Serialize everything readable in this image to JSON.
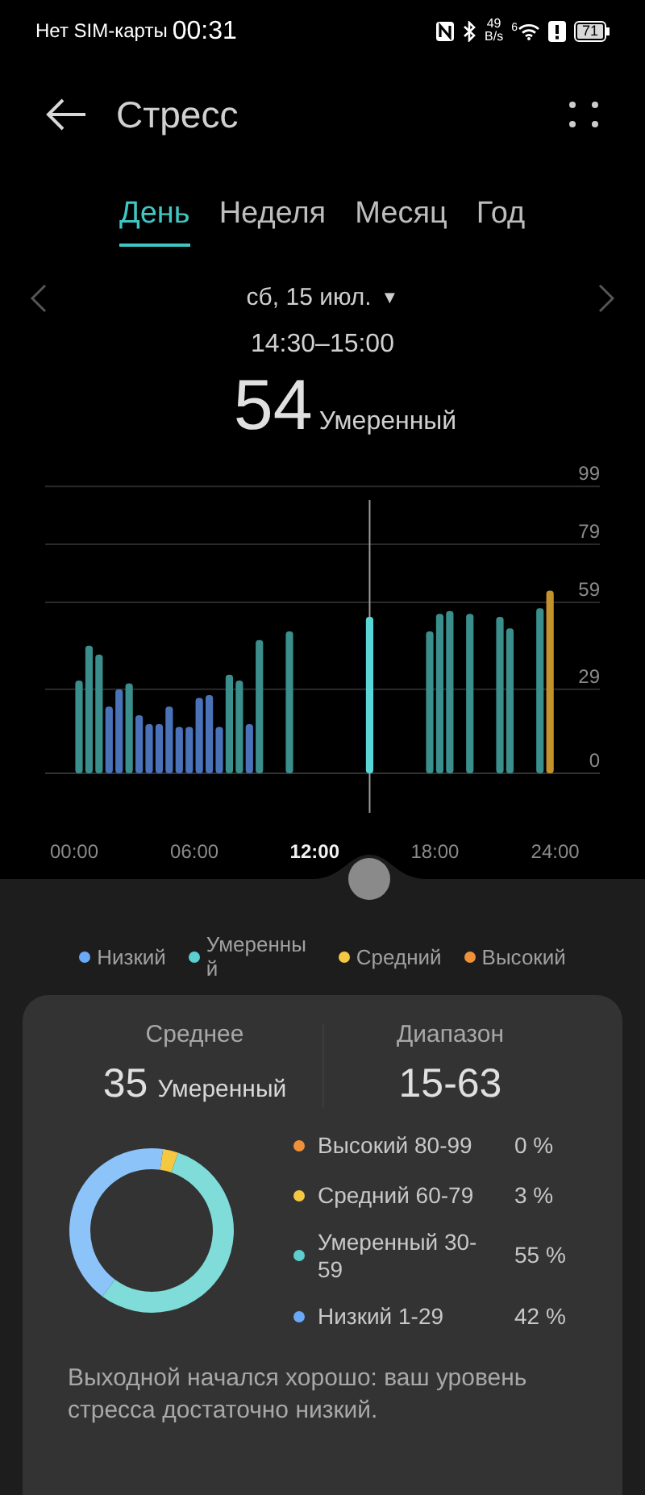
{
  "status_bar": {
    "carrier": "Нет SIM-карты",
    "time": "00:31",
    "net_speed_value": "49",
    "net_speed_unit": "B/s",
    "wifi_label": "6",
    "battery": "71"
  },
  "header": {
    "title": "Стресс"
  },
  "tabs": [
    {
      "label": "День",
      "selected": true
    },
    {
      "label": "Неделя",
      "selected": false
    },
    {
      "label": "Месяц",
      "selected": false
    },
    {
      "label": "Год",
      "selected": false
    }
  ],
  "date_picker": {
    "date": "сб, 15 июл.",
    "dropdown_glyph": "▼"
  },
  "selection": {
    "interval": "14:30–15:00",
    "value": "54",
    "level_label": "Умеренный"
  },
  "chart": {
    "chart_data": {
      "type": "bar",
      "grid": true,
      "ref_lines": [
        {
          "axis": "x",
          "value": 14.5,
          "color": "#9a9a9a"
        }
      ],
      "x": [
        0,
        0.5,
        1,
        1.5,
        2,
        2.5,
        3,
        3.5,
        4,
        4.5,
        5,
        5.5,
        6,
        6.5,
        7,
        7.5,
        8,
        8.5,
        9,
        10.5,
        14.5,
        17.5,
        18,
        18.5,
        19.5,
        21,
        21.5,
        23,
        23.5
      ],
      "series": [
        {
          "color": "#4a72b8",
          "values": [
            null,
            null,
            null,
            23,
            29,
            null,
            20,
            17,
            17,
            23,
            16,
            16,
            26,
            27,
            16,
            null,
            null,
            17,
            null,
            null,
            null,
            null,
            null,
            null,
            null,
            null,
            null,
            null,
            null
          ]
        },
        {
          "color": "#3a8e8c",
          "values": [
            32,
            44,
            41,
            null,
            null,
            31,
            null,
            null,
            null,
            null,
            null,
            null,
            null,
            null,
            null,
            34,
            32,
            null,
            46,
            49,
            null,
            49,
            55,
            56,
            55,
            54,
            50,
            57,
            null
          ]
        },
        {
          "color": "#5ad6d6",
          "values": [
            null,
            null,
            null,
            null,
            null,
            null,
            null,
            null,
            null,
            null,
            null,
            null,
            null,
            null,
            null,
            null,
            null,
            null,
            null,
            null,
            54,
            null,
            null,
            null,
            null,
            null,
            null,
            null,
            null
          ]
        },
        {
          "color": "#c4922c",
          "values": [
            null,
            null,
            null,
            null,
            null,
            null,
            null,
            null,
            null,
            null,
            null,
            null,
            null,
            null,
            null,
            null,
            null,
            null,
            null,
            null,
            null,
            null,
            null,
            null,
            null,
            null,
            null,
            null,
            63
          ]
        }
      ],
      "xlim": [
        0,
        24
      ],
      "ylim": [
        0,
        99
      ],
      "xticks": [
        {
          "value": 0,
          "label": "00:00"
        },
        {
          "value": 6,
          "label": "06:00"
        },
        {
          "value": 12,
          "label": "12:00"
        },
        {
          "value": 18,
          "label": "18:00"
        },
        {
          "value": 24,
          "label": "24:00"
        }
      ],
      "yticks": [
        99,
        79,
        59,
        29,
        0
      ]
    }
  },
  "legend": [
    {
      "label": "Низкий",
      "color": "#6aa9f5"
    },
    {
      "label": "Умеренный",
      "color": "#5ccfcf"
    },
    {
      "label": "Средний",
      "color": "#f5c842"
    },
    {
      "label": "Высокий",
      "color": "#f0913a"
    }
  ],
  "summary": {
    "average_label": "Среднее",
    "average_value": "35",
    "average_level": "Умеренный",
    "range_label": "Диапазон",
    "range_value": "15-63"
  },
  "distribution": [
    {
      "label": "Высокий 80-99",
      "percent": "0 %",
      "color": "#f0913a"
    },
    {
      "label": "Средний 60-79",
      "percent": "3 %",
      "color": "#f5c842"
    },
    {
      "label": "Умеренный 30-59",
      "percent": "55 %",
      "color": "#5ccfcf"
    },
    {
      "label": "Низкий 1-29",
      "percent": "42 %",
      "color": "#6aa9f5"
    }
  ],
  "donut": {
    "chart_data": {
      "type": "donut",
      "values": [
        3,
        55,
        42
      ],
      "colors": [
        "#f5c842",
        "#7fdcd8",
        "#8cc4fa"
      ]
    }
  },
  "insight": "Выходной начался хорошо: ваш уровень стресса достаточно низкий."
}
